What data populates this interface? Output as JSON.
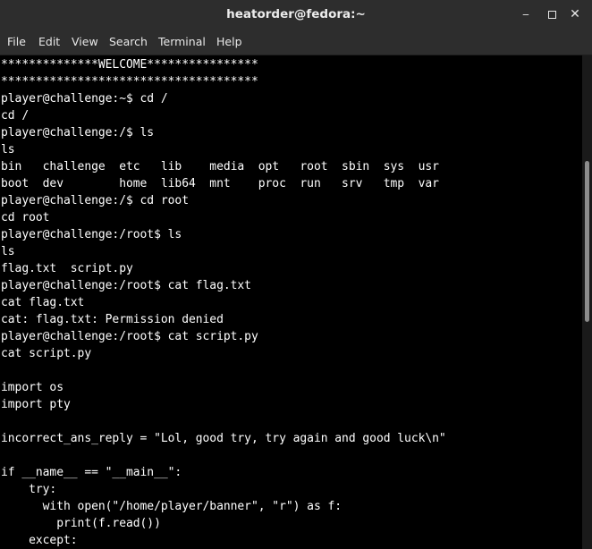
{
  "window": {
    "title": "heatorder@fedora:~",
    "minimize_glyph": "‒",
    "close_glyph": "✕"
  },
  "menubar": {
    "items": [
      "File",
      "Edit",
      "View",
      "Search",
      "Terminal",
      "Help"
    ]
  },
  "terminal": {
    "lines": [
      "**************WELCOME****************",
      "*************************************",
      "player@challenge:~$ cd /",
      "cd /",
      "player@challenge:/$ ls",
      "ls",
      "bin   challenge  etc   lib    media  opt   root  sbin  sys  usr",
      "boot  dev        home  lib64  mnt    proc  run   srv   tmp  var",
      "player@challenge:/$ cd root",
      "cd root",
      "player@challenge:/root$ ls",
      "ls",
      "flag.txt  script.py",
      "player@challenge:/root$ cat flag.txt",
      "cat flag.txt",
      "cat: flag.txt: Permission denied",
      "player@challenge:/root$ cat script.py",
      "cat script.py",
      "",
      "import os",
      "import pty",
      "",
      "incorrect_ans_reply = \"Lol, good try, try again and good luck\\n\"",
      "",
      "if __name__ == \"__main__\":",
      "    try:",
      "      with open(\"/home/player/banner\", \"r\") as f:",
      "        print(f.read())",
      "    except:"
    ]
  }
}
